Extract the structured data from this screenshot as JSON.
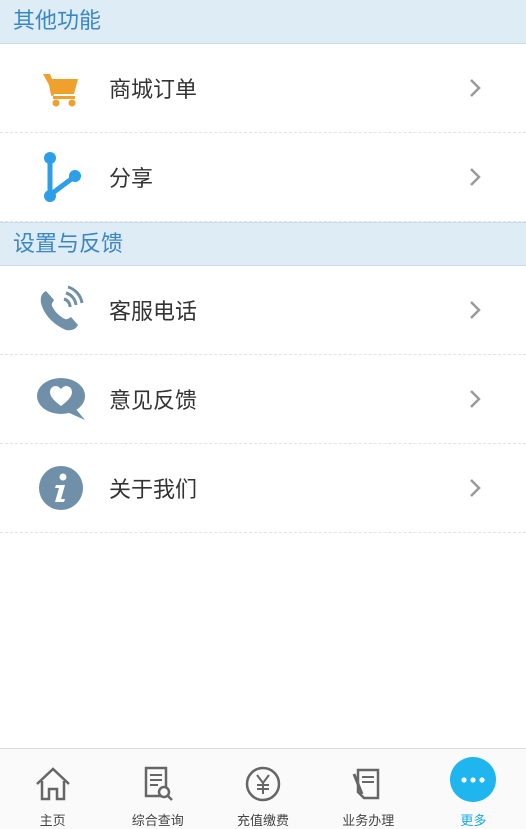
{
  "sections": {
    "other": {
      "title": "其他功能",
      "items": [
        {
          "label": "商城订单",
          "icon": "cart-icon"
        },
        {
          "label": "分享",
          "icon": "share-icon"
        }
      ]
    },
    "settings": {
      "title": "设置与反馈",
      "items": [
        {
          "label": "客服电话",
          "icon": "phone-icon"
        },
        {
          "label": "意见反馈",
          "icon": "feedback-icon"
        },
        {
          "label": "关于我们",
          "icon": "info-icon"
        }
      ]
    }
  },
  "tabbar": {
    "tabs": [
      {
        "label": "主页",
        "icon": "home-icon"
      },
      {
        "label": "综合查询",
        "icon": "query-icon"
      },
      {
        "label": "充值缴费",
        "icon": "yen-icon"
      },
      {
        "label": "业务办理",
        "icon": "document-icon"
      },
      {
        "label": "更多",
        "icon": "more-icon",
        "active": true
      }
    ]
  },
  "colors": {
    "header_bg": "#deecf6",
    "header_text": "#3b86c4",
    "accent": "#1fb6f0",
    "cart_orange": "#f0a12c",
    "share_blue": "#2d9ee8",
    "icon_slate": "#6f90a8"
  }
}
